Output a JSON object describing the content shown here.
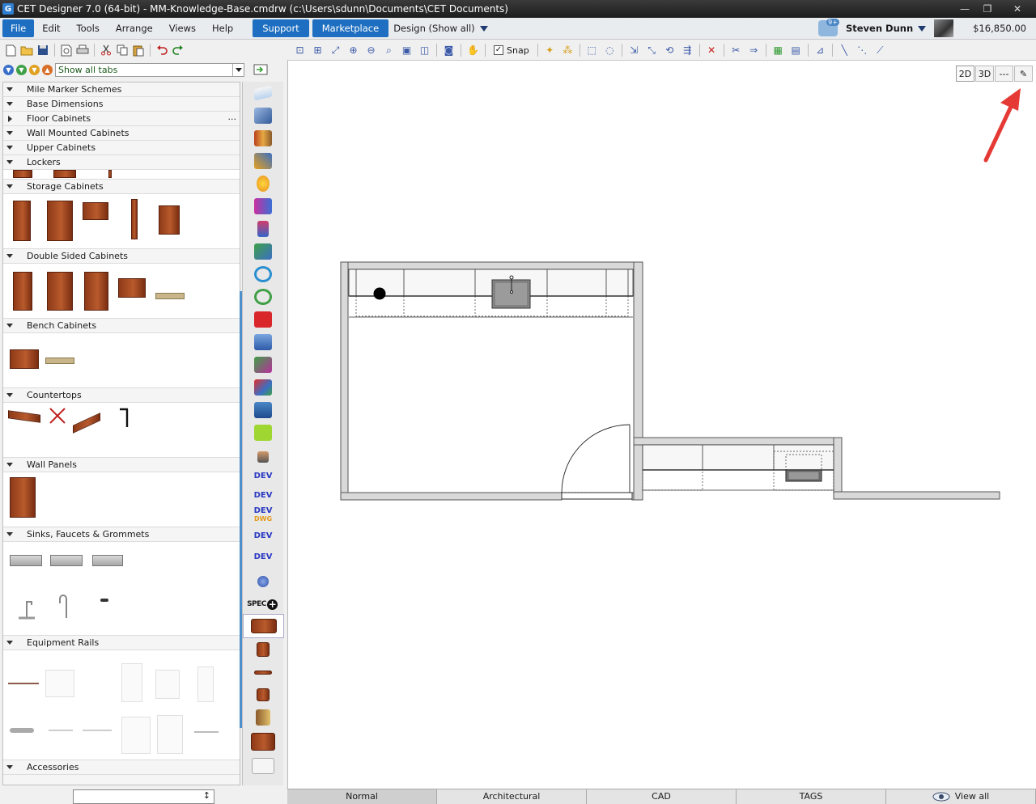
{
  "titlebar": {
    "logo": "G",
    "title": "CET Designer 7.0 (64-bit) - MM-Knowledge-Base.cmdrw (c:\\Users\\sdunn\\Documents\\CET Documents)",
    "minimize": "—",
    "restore": "❐",
    "close": "✕"
  },
  "menubar": {
    "items": [
      "File",
      "Edit",
      "Tools",
      "Arrange",
      "Views",
      "Help"
    ],
    "support": "Support",
    "marketplace": "Marketplace",
    "design_selector": "Design (Show all)",
    "notification_badge": "9+",
    "user_name": "Steven Dunn",
    "price": "$16,850.00"
  },
  "left_panel": {
    "tab_selector": "Show all tabs",
    "categories": [
      "Mile Marker Schemes",
      "Base Dimensions",
      "Floor Cabinets",
      "Wall Mounted Cabinets",
      "Upper Cabinets",
      "Lockers",
      "Storage Cabinets",
      "Double Sided Cabinets",
      "Bench Cabinets",
      "Countertops",
      "Wall Panels",
      "Sinks, Faucets & Grommets",
      "Equipment Rails",
      "Accessories"
    ],
    "more_label": "..."
  },
  "vstrip": {
    "dev_label": "DEV",
    "dwg_label": "DWG",
    "spec_label": "SPEC",
    "spec_plus": "+"
  },
  "main_toolbar": {
    "snap_label": "Snap",
    "snap_checked": "✓"
  },
  "canvas": {
    "view_2d": "2D",
    "view_3d": "3D",
    "view_dims": "---",
    "view_edit": "✎"
  },
  "bottom_tabs": [
    "Normal",
    "Architectural",
    "CAD",
    "TAGS",
    "View all"
  ],
  "left_bottom": {
    "scroll_glyph": "↕"
  },
  "colors": {
    "accent_blue": "#1e6fc1",
    "arrow_red": "#e53935",
    "wall_gray": "#d9d9d9"
  }
}
